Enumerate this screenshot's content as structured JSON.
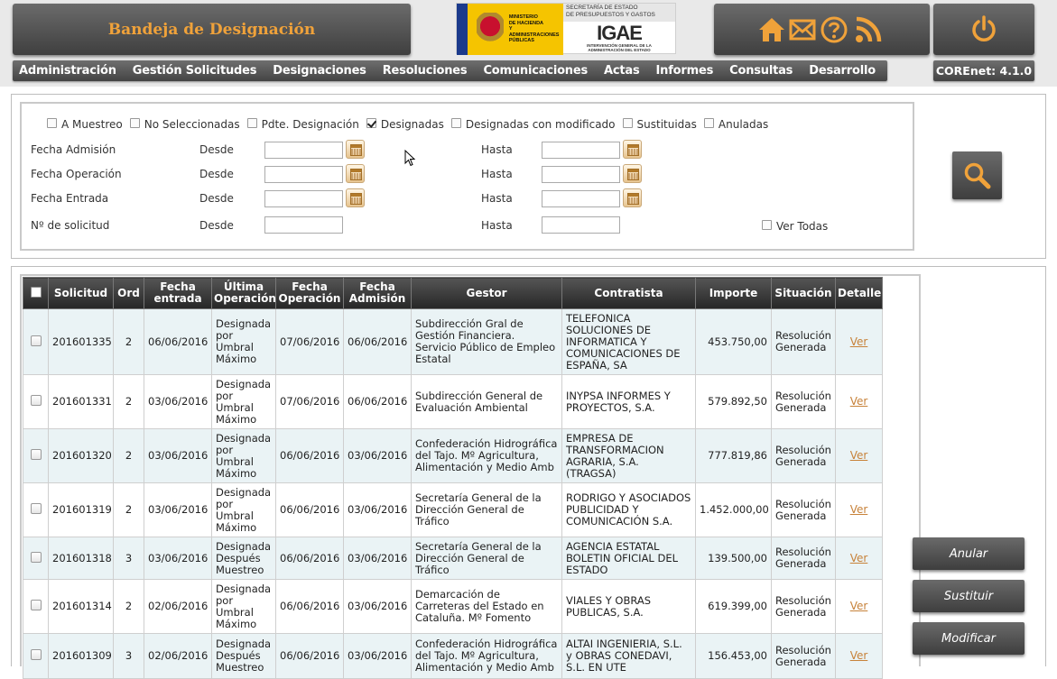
{
  "header": {
    "title": "Bandeja de Designación",
    "logo": {
      "ministry": [
        "MINISTERIO",
        "DE HACIENDA",
        "Y ADMINISTRACIONES",
        "PÚBLICAS"
      ],
      "secretary": [
        "SECRETARÍA DE ESTADO",
        "DE PRESUPUESTOS Y GASTOS"
      ],
      "brand": "IGAE",
      "brand_sub": [
        "INTERVENCIÓN GENERAL DE LA",
        "ADMINISTRACIÓN DEL ESTADO"
      ]
    },
    "icons": [
      "home-icon",
      "mail-icon",
      "help-icon",
      "rss-icon",
      "power-icon"
    ],
    "accent_color": "#f0a23a"
  },
  "menu": {
    "items": [
      "Administración",
      "Gestión Solicitudes",
      "Designaciones",
      "Resoluciones",
      "Comunicaciones",
      "Actas",
      "Informes",
      "Consultas",
      "Desarrollo"
    ],
    "version": "COREnet: 4.1.0"
  },
  "filters": {
    "status_checks": [
      {
        "label": "A Muestreo",
        "checked": false
      },
      {
        "label": "No Seleccionadas",
        "checked": false
      },
      {
        "label": "Pdte. Designación",
        "checked": false
      },
      {
        "label": "Designadas",
        "checked": true
      },
      {
        "label": "Designadas con modificado",
        "checked": false
      },
      {
        "label": "Sustituidas",
        "checked": false
      },
      {
        "label": "Anuladas",
        "checked": false
      }
    ],
    "date_rows": [
      {
        "label": "Fecha Admisión",
        "from": "Desde",
        "to": "Hasta"
      },
      {
        "label": "Fecha Operación",
        "from": "Desde",
        "to": "Hasta"
      },
      {
        "label": "Fecha Entrada",
        "from": "Desde",
        "to": "Hasta"
      }
    ],
    "solicitud_row": {
      "label": "Nº de solicitud",
      "from": "Desde",
      "to": "Hasta"
    },
    "ver_todas": {
      "label": "Ver Todas",
      "checked": false
    }
  },
  "table": {
    "columns": [
      "Solicitud",
      "Ord",
      "Fecha entrada",
      "Última Operación",
      "Fecha Operación",
      "Fecha Admisión",
      "Gestor",
      "Contratista",
      "Importe",
      "Situación",
      "Detalle"
    ],
    "rows": [
      {
        "solicitud": "201601335",
        "ord": "2",
        "fecha_entrada": "06/06/2016",
        "ultima": "Designada por Umbral Máximo",
        "fecha_op": "07/06/2016",
        "fecha_adm": "06/06/2016",
        "gestor": "Subdirección Gral de Gestión Financiera. Servicio Público de Empleo Estatal",
        "contratista": "TELEFONICA SOLUCIONES DE INFORMATICA Y COMUNICACIONES DE ESPAÑA, SA",
        "importe": "453.750,00",
        "situacion": "Resolución Generada",
        "detalle": "Ver"
      },
      {
        "solicitud": "201601331",
        "ord": "2",
        "fecha_entrada": "03/06/2016",
        "ultima": "Designada por Umbral Máximo",
        "fecha_op": "07/06/2016",
        "fecha_adm": "06/06/2016",
        "gestor": "Subdirección General de Evaluación Ambiental",
        "contratista": "INYPSA INFORMES Y PROYECTOS, S.A.",
        "importe": "579.892,50",
        "situacion": "Resolución Generada",
        "detalle": "Ver"
      },
      {
        "solicitud": "201601320",
        "ord": "2",
        "fecha_entrada": "03/06/2016",
        "ultima": "Designada por Umbral Máximo",
        "fecha_op": "06/06/2016",
        "fecha_adm": "03/06/2016",
        "gestor": "Confederación Hidrográfica del Tajo. Mº Agricultura, Alimentación y Medio Amb",
        "contratista": "EMPRESA DE TRANSFORMACION AGRARIA, S.A. (TRAGSA)",
        "importe": "777.819,86",
        "situacion": "Resolución Generada",
        "detalle": "Ver"
      },
      {
        "solicitud": "201601319",
        "ord": "2",
        "fecha_entrada": "03/06/2016",
        "ultima": "Designada por Umbral Máximo",
        "fecha_op": "06/06/2016",
        "fecha_adm": "03/06/2016",
        "gestor": "Secretaría General de la Dirección General de Tráfico",
        "contratista": "RODRIGO Y ASOCIADOS PUBLICIDAD Y COMUNICACIÓN S.A.",
        "importe": "1.452.000,00",
        "situacion": "Resolución Generada",
        "detalle": "Ver"
      },
      {
        "solicitud": "201601318",
        "ord": "3",
        "fecha_entrada": "03/06/2016",
        "ultima": "Designada Después Muestreo",
        "fecha_op": "06/06/2016",
        "fecha_adm": "03/06/2016",
        "gestor": "Secretaría General de la Dirección General de Tráfico",
        "contratista": "AGENCIA ESTATAL BOLETIN OFICIAL DEL ESTADO",
        "importe": "139.500,00",
        "situacion": "Resolución Generada",
        "detalle": "Ver"
      },
      {
        "solicitud": "201601314",
        "ord": "2",
        "fecha_entrada": "02/06/2016",
        "ultima": "Designada por Umbral Máximo",
        "fecha_op": "06/06/2016",
        "fecha_adm": "03/06/2016",
        "gestor": "Demarcación de Carreteras del Estado en Cataluña. Mº Fomento",
        "contratista": "VIALES Y OBRAS PUBLICAS, S.A.",
        "importe": "619.399,00",
        "situacion": "Resolución Generada",
        "detalle": "Ver"
      },
      {
        "solicitud": "201601309",
        "ord": "3",
        "fecha_entrada": "02/06/2016",
        "ultima": "Designada Después Muestreo",
        "fecha_op": "06/06/2016",
        "fecha_adm": "03/06/2016",
        "gestor": "Confederación Hidrográfica del Tajo. Mº Agricultura, Alimentación y Medio Amb",
        "contratista": "ALTAI INGENIERIA, S.L. y OBRAS CONEDAVI, S.L. EN UTE",
        "importe": "156.453,00",
        "situacion": "Resolución Generada",
        "detalle": "Ver"
      }
    ]
  },
  "actions": {
    "anular": "Anular",
    "sustituir": "Sustituir",
    "modificar": "Modificar"
  }
}
